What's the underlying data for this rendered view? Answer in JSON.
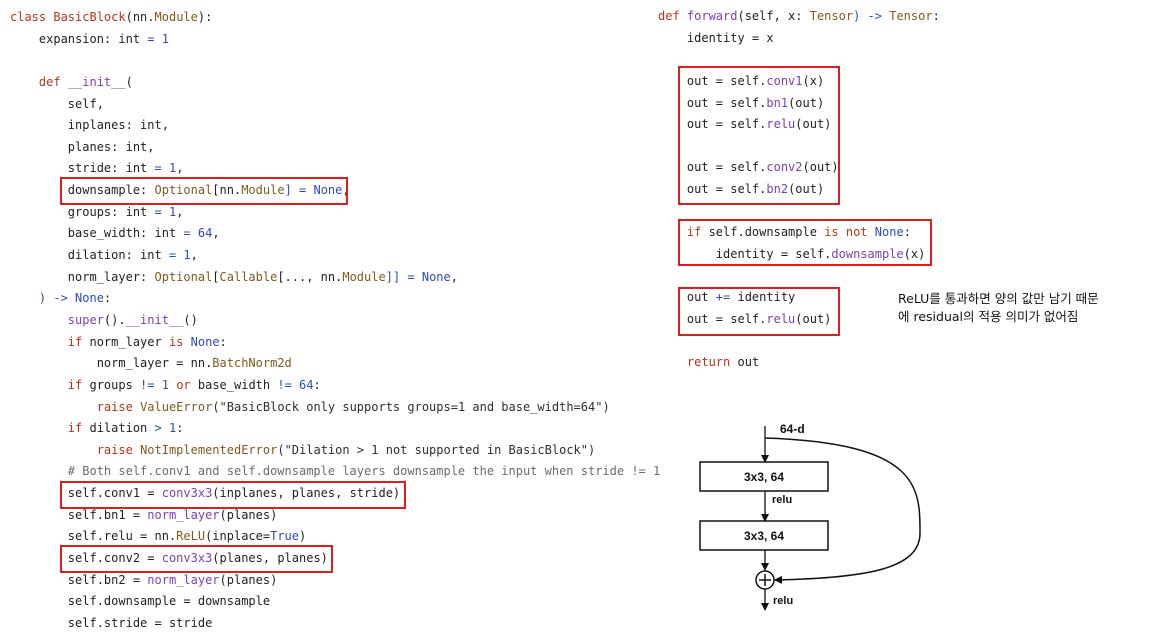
{
  "left_code": {
    "l1": {
      "a": "class ",
      "b": "BasicBlock",
      "c": "(nn.",
      "d": "Module",
      "e": "):"
    },
    "l2": {
      "a": "    expansion: ",
      "b": "int",
      "c": " = ",
      "d": "1"
    },
    "l4": {
      "a": "    ",
      "b": "def ",
      "c": "__init__",
      "d": "("
    },
    "l5": "        self,",
    "l6": {
      "a": "        inplanes: ",
      "b": "int",
      "c": ","
    },
    "l7": {
      "a": "        planes: ",
      "b": "int",
      "c": ","
    },
    "l8": {
      "a": "        stride: ",
      "b": "int",
      "c": " = ",
      "d": "1",
      "e": ","
    },
    "l9": {
      "a": "        downsample: ",
      "b": "Optional",
      "c": "[nn.",
      "d": "Module",
      "e": "] = ",
      "f": "None",
      "g": ","
    },
    "l10": {
      "a": "        groups: ",
      "b": "int",
      "c": " = ",
      "d": "1",
      "e": ","
    },
    "l11": {
      "a": "        base_width: ",
      "b": "int",
      "c": " = ",
      "d": "64",
      "e": ","
    },
    "l12": {
      "a": "        dilation: ",
      "b": "int",
      "c": " = ",
      "d": "1",
      "e": ","
    },
    "l13": {
      "a": "        norm_layer: ",
      "b": "Optional",
      "c": "[",
      "d": "Callable",
      "e": "[..., nn.",
      "f": "Module",
      "g": "]] = ",
      "h": "None",
      "i": ","
    },
    "l14": {
      "a": "    ) -> ",
      "b": "None",
      "c": ":"
    },
    "l15": {
      "a": "        ",
      "b": "super",
      "c": "().",
      "d": "__init__",
      "e": "()"
    },
    "l16": {
      "a": "        ",
      "b": "if",
      "c": " norm_layer ",
      "d": "is",
      "e": " ",
      "f": "None",
      "g": ":"
    },
    "l17": {
      "a": "            norm_layer = nn.",
      "b": "BatchNorm2d"
    },
    "l18": {
      "a": "        ",
      "b": "if",
      "c": " groups ",
      "d": "!=",
      "e": " ",
      "f": "1",
      "g": " ",
      "h": "or",
      "i": " base_width ",
      "j": "!=",
      "k": " ",
      "l": "64",
      "m": ":"
    },
    "l19": {
      "a": "            ",
      "b": "raise ",
      "c": "ValueError",
      "d": "(\"BasicBlock only supports groups=1 and base_width=64\")"
    },
    "l20": {
      "a": "        ",
      "b": "if",
      "c": " dilation ",
      "d": ">",
      "e": " ",
      "f": "1",
      "g": ":"
    },
    "l21": {
      "a": "            ",
      "b": "raise ",
      "c": "NotImplementedError",
      "d": "(\"Dilation > 1 not supported in BasicBlock\")"
    },
    "l22": "        # Both self.conv1 and self.downsample layers downsample the input when stride != 1",
    "l23": {
      "a": "        self.conv1 = ",
      "b": "conv3x3",
      "c": "(inplanes, planes, stride)"
    },
    "l24": {
      "a": "        self.bn1 = ",
      "b": "norm_layer",
      "c": "(planes)"
    },
    "l25": {
      "a": "        self.relu = nn.",
      "b": "ReLU",
      "c": "(inplace=",
      "d": "True",
      "e": ")"
    },
    "l26": {
      "a": "        self.conv2 = ",
      "b": "conv3x3",
      "c": "(planes, planes)"
    },
    "l27": {
      "a": "        self.bn2 = ",
      "b": "norm_layer",
      "c": "(planes)"
    },
    "l28": "        self.downsample = downsample",
    "l29": "        self.stride = stride"
  },
  "right_code": {
    "r1": {
      "a": "def ",
      "b": "forward",
      "c": "(self, x: ",
      "d": "Tensor",
      "e": ") -> ",
      "f": "Tensor",
      "g": ":"
    },
    "r2": "    identity = x",
    "r4": {
      "a": "    out = self.",
      "b": "conv1",
      "c": "(x)"
    },
    "r5": {
      "a": "    out = self.",
      "b": "bn1",
      "c": "(out)"
    },
    "r6": {
      "a": "    out = self.",
      "b": "relu",
      "c": "(out)"
    },
    "r8": {
      "a": "    out = self.",
      "b": "conv2",
      "c": "(out)"
    },
    "r9": {
      "a": "    out = self.",
      "b": "bn2",
      "c": "(out)"
    },
    "r11": {
      "a": "    ",
      "b": "if",
      "c": " self.downsample ",
      "d": "is not",
      "e": " ",
      "f": "None",
      "g": ":"
    },
    "r12": {
      "a": "        identity = self.",
      "b": "downsample",
      "c": "(x)"
    },
    "r14": {
      "a": "    out ",
      "b": "+=",
      "c": " identity"
    },
    "r15": {
      "a": "    out = self.",
      "b": "relu",
      "c": "(out)"
    },
    "r17": {
      "a": "    ",
      "b": "return",
      "c": " out"
    }
  },
  "note": {
    "line1": "ReLU를 통과하면 양의 값만 남기 때문",
    "line2": "에 residual의 적용 의미가 없어짐"
  },
  "diagram": {
    "input_label": "64-d",
    "layer1": "3x3, 64",
    "layer2": "3x3, 64",
    "relu1": "relu",
    "relu2": "relu",
    "add_symbol": "+"
  },
  "colors": {
    "highlight_box": "#e11d1d",
    "keyword": "#b4351b",
    "function": "#7a3fb3",
    "number": "#2b4bbd"
  }
}
